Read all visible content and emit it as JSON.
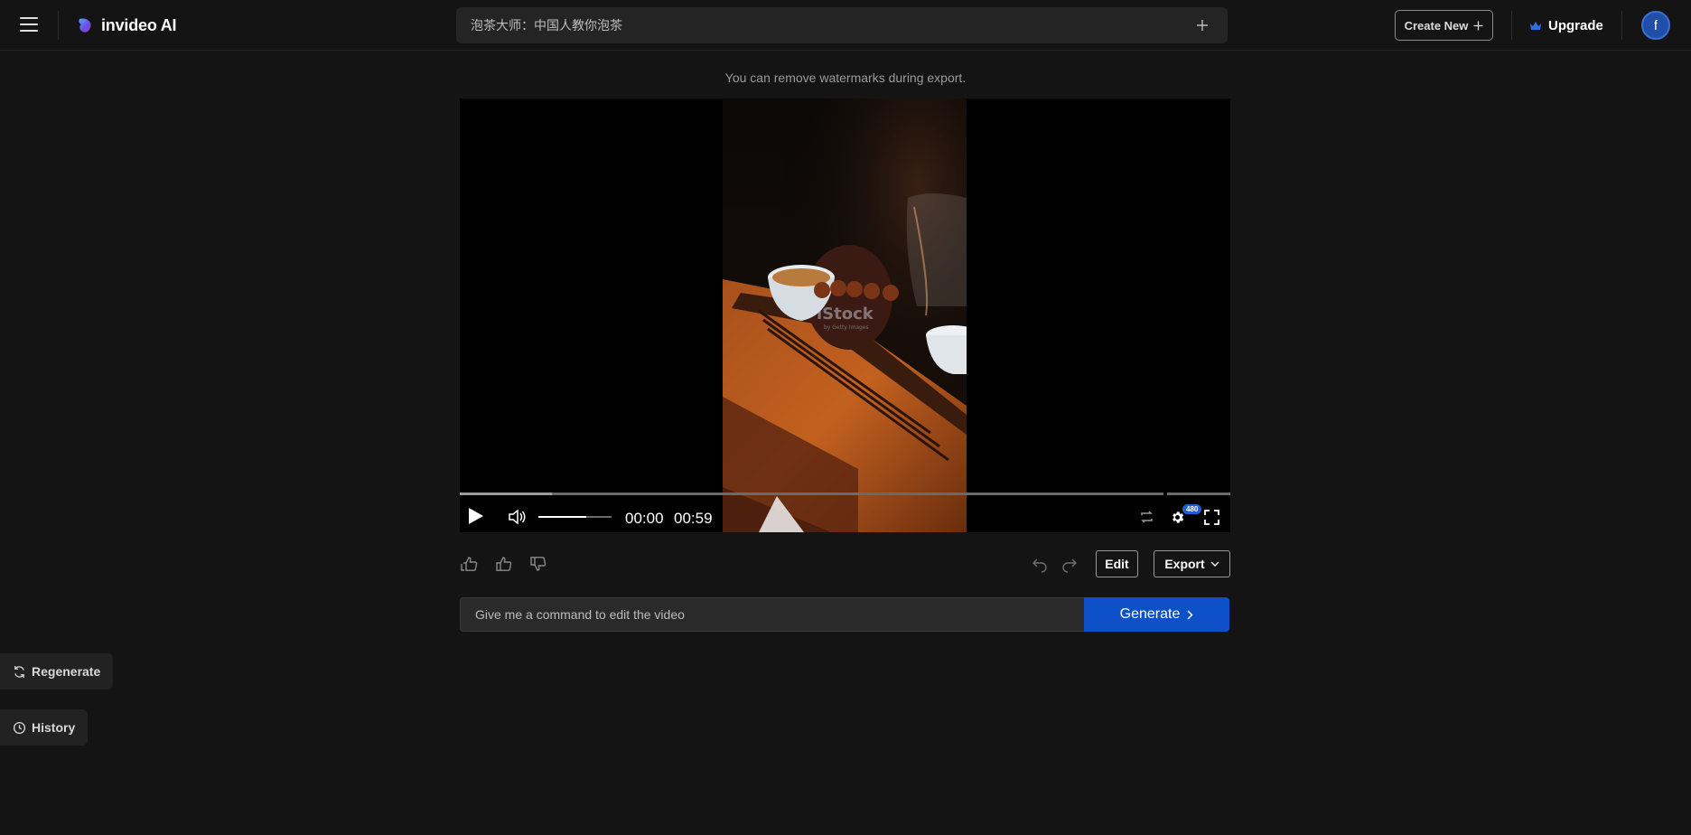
{
  "header": {
    "brand": "invideo AI",
    "project_title": "泡茶大师：中国人教你泡茶",
    "create_new_label": "Create New",
    "upgrade_label": "Upgrade",
    "avatar_initial": "f"
  },
  "notice": "You can remove watermarks during export.",
  "player": {
    "current_time": "00:00",
    "duration": "00:59",
    "quality_badge": "480",
    "watermark_text": "iStock",
    "watermark_subtext": "by Getty Images",
    "progress_buffered_percent": 12,
    "volume_percent": 66
  },
  "actions": {
    "edit_label": "Edit",
    "export_label": "Export"
  },
  "command": {
    "placeholder": "Give me a command to edit the video",
    "generate_label": "Generate"
  },
  "side": {
    "regenerate_label": "Regenerate",
    "history_label": "History"
  },
  "colors": {
    "background": "#141414",
    "accent_blue": "#0d50c8",
    "upgrade_crown": "#2f6fe6"
  }
}
